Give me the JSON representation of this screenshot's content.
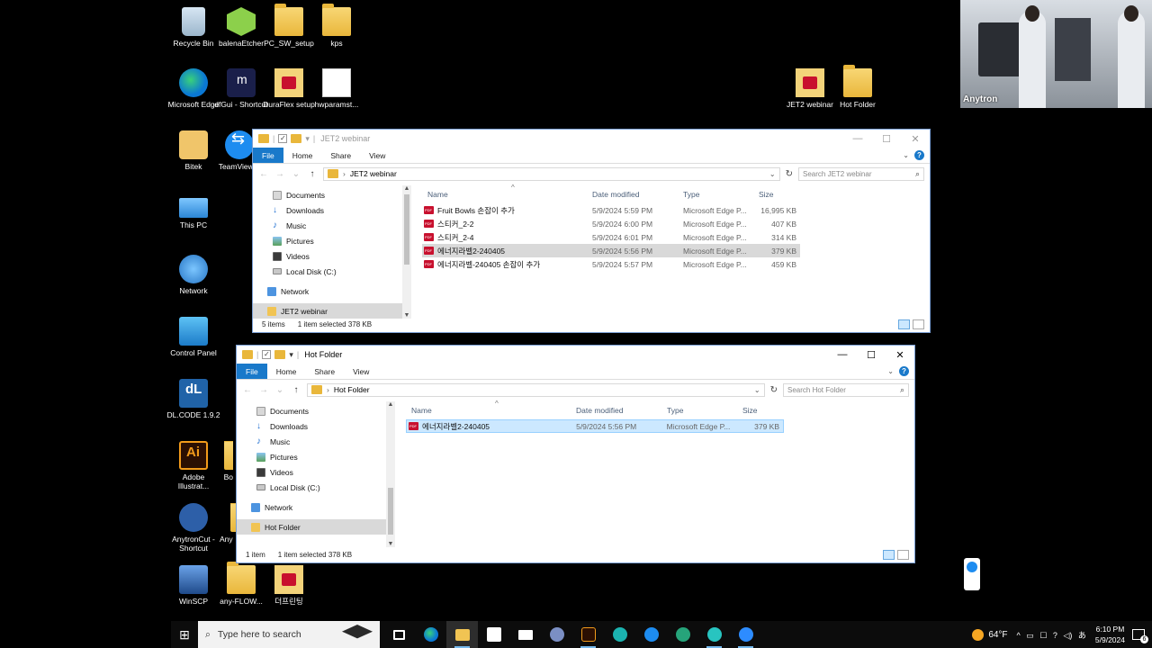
{
  "desktop": {
    "icons": [
      {
        "label": "Recycle Bin"
      },
      {
        "label": "balenaEtcher"
      },
      {
        "label": "PC_SW_setup"
      },
      {
        "label": "kps"
      },
      {
        "label": "Microsoft Edge"
      },
      {
        "label": "dfGui - Shortcut"
      },
      {
        "label": "DuraFlex setup"
      },
      {
        "label": "hwparamst..."
      },
      {
        "label": "Bitek"
      },
      {
        "label": "TeamViewer"
      },
      {
        "label": "This PC"
      },
      {
        "label": "Network"
      },
      {
        "label": "Control Panel"
      },
      {
        "label": "DL.CODE 1.9.2"
      },
      {
        "label": "Adobe Illustrat..."
      },
      {
        "label": "AnytronCut - Shortcut"
      },
      {
        "label": "WinSCP"
      },
      {
        "label": "any-FLOW..."
      },
      {
        "label": "더프린팅"
      },
      {
        "label": "JET2 webinar"
      },
      {
        "label": "Hot Folder"
      },
      {
        "label": "Bo"
      },
      {
        "label": "Any"
      }
    ]
  },
  "webcam": {
    "label": "Anytron"
  },
  "explorer_nav": {
    "documents": "Documents",
    "downloads": "Downloads",
    "music": "Music",
    "pictures": "Pictures",
    "videos": "Videos",
    "local_disk": "Local Disk (C:)",
    "network": "Network"
  },
  "ribbon": {
    "file": "File",
    "home": "Home",
    "share": "Share",
    "view": "View"
  },
  "columns": {
    "name": "Name",
    "date": "Date modified",
    "type": "Type",
    "size": "Size"
  },
  "window_jet2": {
    "title": "JET2 webinar",
    "address": "JET2 webinar",
    "search_placeholder": "Search JET2 webinar",
    "selected_nav": "JET2 webinar",
    "files": [
      {
        "name": "Fruit Bowls 손잡이 추가",
        "date": "5/9/2024 5:59 PM",
        "type": "Microsoft Edge P...",
        "size": "16,995 KB"
      },
      {
        "name": "스티커_2-2",
        "date": "5/9/2024 6:00 PM",
        "type": "Microsoft Edge P...",
        "size": "407 KB"
      },
      {
        "name": "스티커_2-4",
        "date": "5/9/2024 6:01 PM",
        "type": "Microsoft Edge P...",
        "size": "314 KB"
      },
      {
        "name": "에너지라벨2-240405",
        "date": "5/9/2024 5:56 PM",
        "type": "Microsoft Edge P...",
        "size": "379 KB"
      },
      {
        "name": "에너지라벨-240405 손잡이 추가",
        "date": "5/9/2024 5:57 PM",
        "type": "Microsoft Edge P...",
        "size": "459 KB"
      }
    ],
    "status_items": "5 items",
    "status_selected": "1 item selected  378 KB"
  },
  "window_hot": {
    "title": "Hot Folder",
    "address": "Hot Folder",
    "search_placeholder": "Search Hot Folder",
    "selected_nav": "Hot Folder",
    "files": [
      {
        "name": "에너지라벨2-240405",
        "date": "5/9/2024 5:56 PM",
        "type": "Microsoft Edge P...",
        "size": "379 KB"
      }
    ],
    "status_items": "1 item",
    "status_selected": "1 item selected  378 KB"
  },
  "taskbar": {
    "search_placeholder": "Type here to search",
    "weather": "64°F",
    "time": "6:10 PM",
    "date": "5/9/2024"
  },
  "colors": {
    "accent": "#1979ca",
    "selection": "#cce8ff",
    "taskbar": "#0c0c0c"
  }
}
